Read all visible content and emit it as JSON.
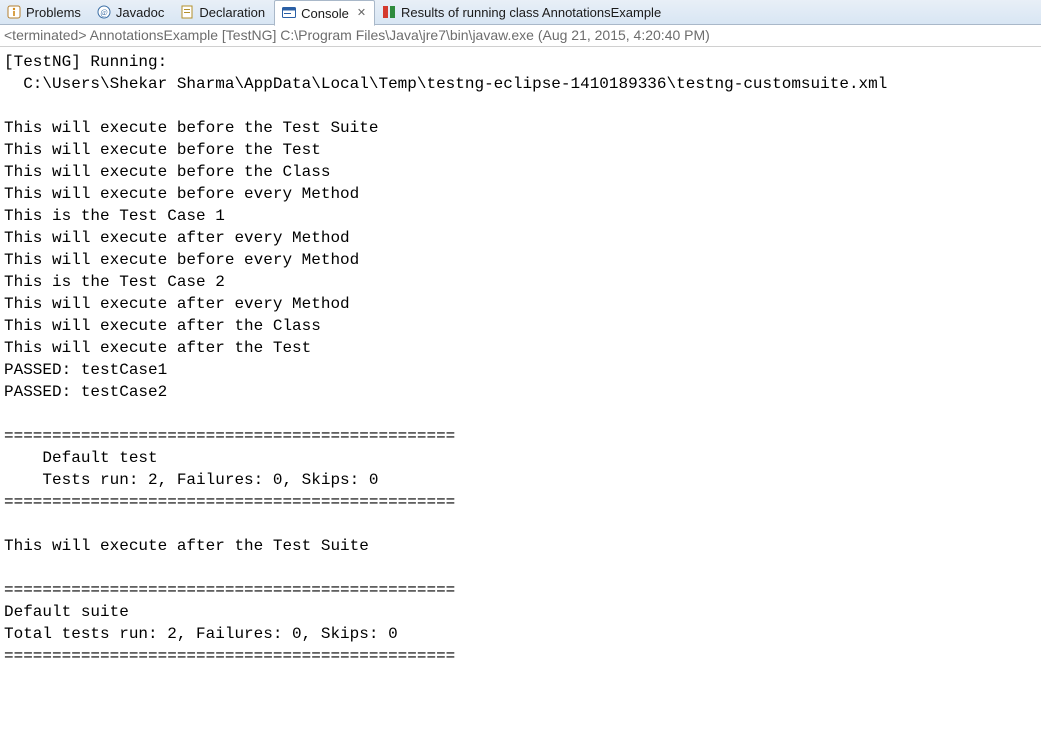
{
  "tabs": {
    "problems": "Problems",
    "javadoc": "Javadoc",
    "declaration": "Declaration",
    "console": "Console",
    "results": "Results of running class AnnotationsExample"
  },
  "launch": {
    "prefix": "<terminated>",
    "body": " AnnotationsExample [TestNG] C:\\Program Files\\Java\\jre7\\bin\\javaw.exe (Aug 21, 2015, 4:20:40 PM)"
  },
  "output": "[TestNG] Running:\n  C:\\Users\\Shekar Sharma\\AppData\\Local\\Temp\\testng-eclipse-1410189336\\testng-customsuite.xml\n\nThis will execute before the Test Suite\nThis will execute before the Test\nThis will execute before the Class\nThis will execute before every Method\nThis is the Test Case 1\nThis will execute after every Method\nThis will execute before every Method\nThis is the Test Case 2\nThis will execute after every Method\nThis will execute after the Class\nThis will execute after the Test\nPASSED: testCase1\nPASSED: testCase2\n\n===============================================\n    Default test\n    Tests run: 2, Failures: 0, Skips: 0\n===============================================\n\nThis will execute after the Test Suite\n\n===============================================\nDefault suite\nTotal tests run: 2, Failures: 0, Skips: 0\n==============================================="
}
